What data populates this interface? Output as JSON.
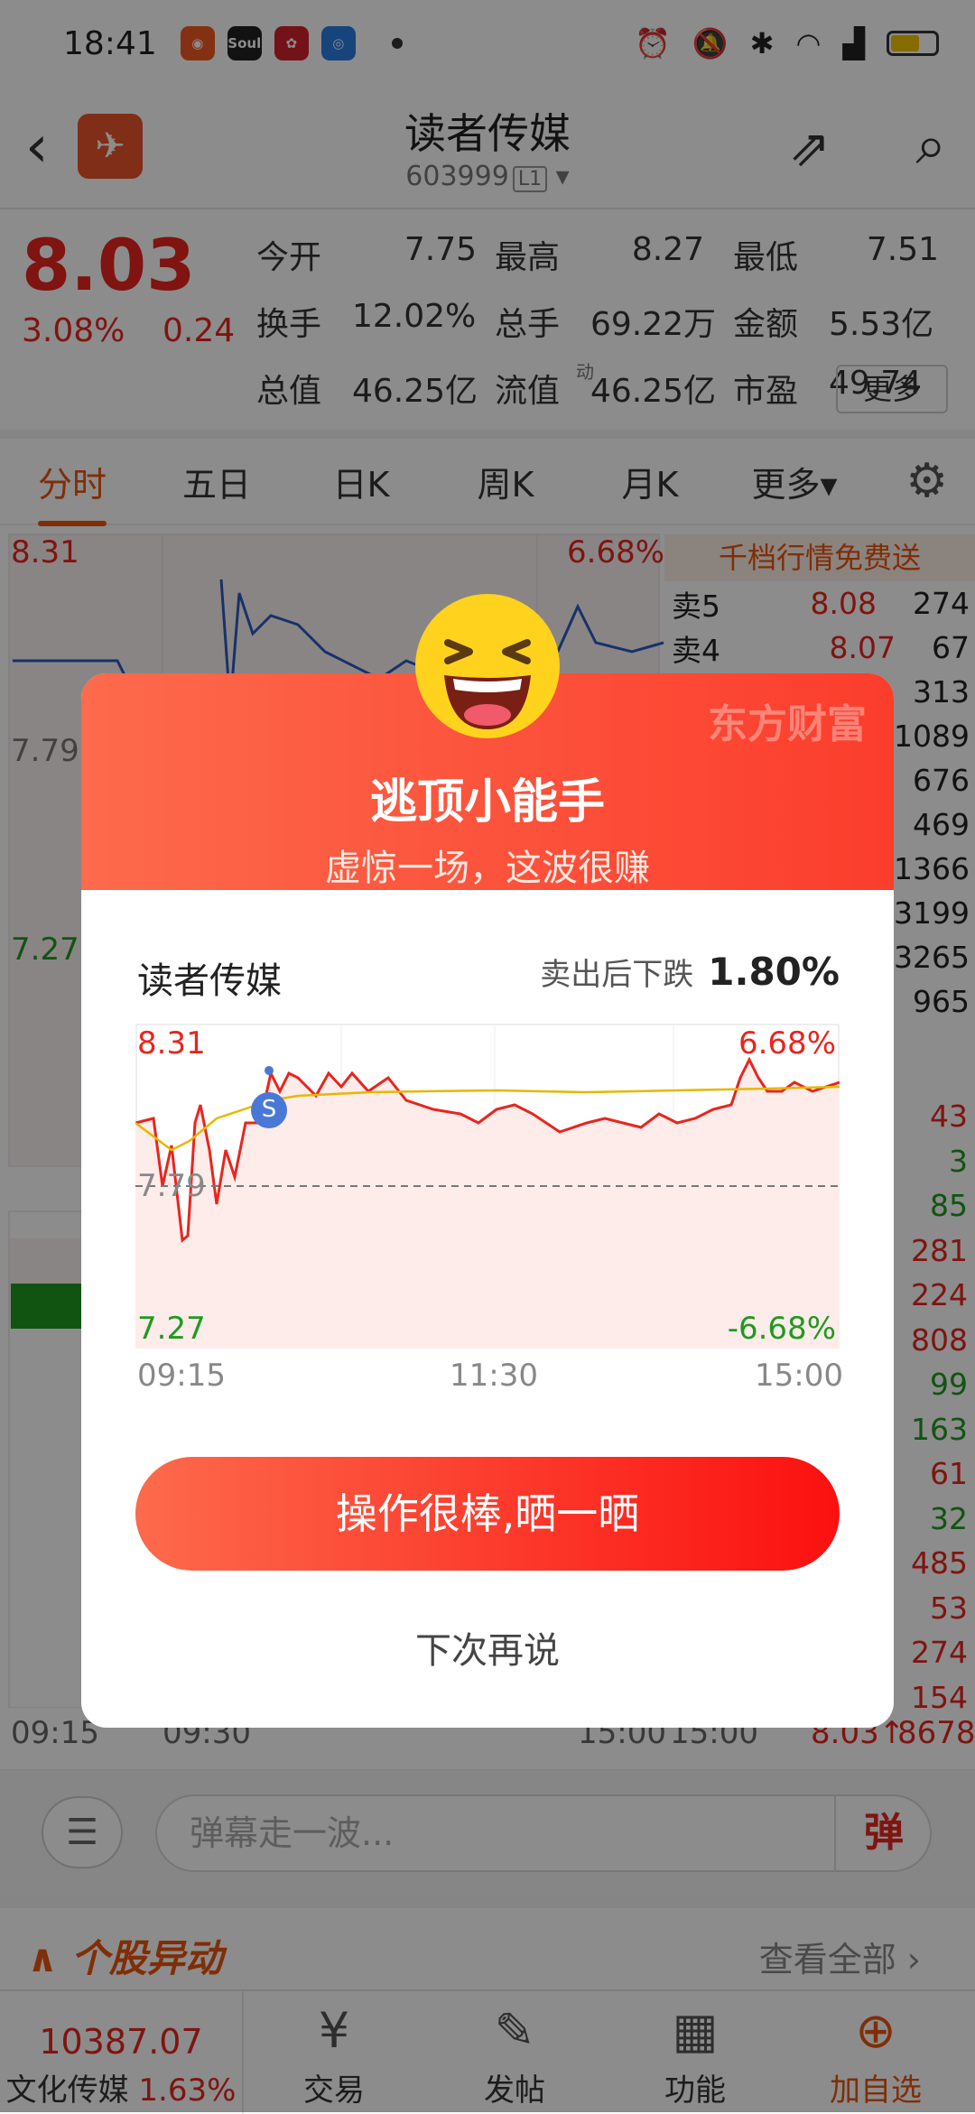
{
  "status": {
    "time": "18:41",
    "apps": [
      "Soul"
    ]
  },
  "header": {
    "title": "读者传媒",
    "code": "603999",
    "level": "L1"
  },
  "quote": {
    "price": "8.03",
    "pct": "3.08%",
    "chg": "0.24",
    "cells": [
      {
        "k": "今开",
        "v": "7.75",
        "c": "green"
      },
      {
        "k": "最高",
        "v": "8.27",
        "c": "red"
      },
      {
        "k": "最低",
        "v": "7.51",
        "c": "green"
      },
      {
        "k": "换手",
        "v": "12.02%",
        "c": ""
      },
      {
        "k": "总手",
        "v": "69.22万",
        "c": ""
      },
      {
        "k": "金额",
        "v": "5.53亿",
        "c": ""
      },
      {
        "k": "总值",
        "v": "46.25亿",
        "c": ""
      },
      {
        "k": "流值",
        "v": "46.25亿",
        "c": ""
      },
      {
        "k": "市盈",
        "v": "49.74",
        "c": ""
      }
    ],
    "pe_tag": "动",
    "more": "更多"
  },
  "tabs": [
    "分时",
    "五日",
    "日K",
    "周K",
    "月K",
    "更多▾"
  ],
  "bg_chart": {
    "high": "8.31",
    "mid": "7.79",
    "low": "7.27",
    "pct_high": "6.68%",
    "t1": "09:15",
    "t2": "09:30",
    "t3": "15:00"
  },
  "orderbook": {
    "free": "千档行情免费送",
    "rows": [
      {
        "n": "卖5",
        "p": "8.08",
        "v": "274"
      },
      {
        "n": "卖4",
        "p": "8.07",
        "v": "67"
      },
      {
        "n": "",
        "p": "",
        "v": "313"
      },
      {
        "n": "",
        "p": "",
        "v": "1089"
      },
      {
        "n": "",
        "p": "",
        "v": "676"
      },
      {
        "n": "",
        "p": "",
        "v": "469"
      },
      {
        "n": "",
        "p": "",
        "v": "1366"
      },
      {
        "n": "",
        "p": "",
        "v": "3199"
      },
      {
        "n": "",
        "p": "",
        "v": "3265"
      },
      {
        "n": "",
        "p": "",
        "v": "965"
      }
    ],
    "trades": [
      {
        "v": "43",
        "c": "red"
      },
      {
        "v": "3",
        "c": "green"
      },
      {
        "v": "85",
        "c": "green"
      },
      {
        "v": "281",
        "c": "red"
      },
      {
        "v": "224",
        "c": "red"
      },
      {
        "v": "808",
        "c": "red"
      },
      {
        "v": "99",
        "c": "green"
      },
      {
        "v": "163",
        "c": "green"
      },
      {
        "v": "61",
        "c": "red"
      },
      {
        "v": "32",
        "c": "green"
      },
      {
        "v": "485",
        "c": "red"
      },
      {
        "v": "53",
        "c": "red"
      },
      {
        "v": "274",
        "c": "red"
      },
      {
        "v": "154",
        "c": "red"
      }
    ],
    "last": {
      "time": "15:00",
      "price": "8.03↑",
      "vol": "8678"
    }
  },
  "danmu": {
    "placeholder": "弹幕走一波...",
    "btn": "弹"
  },
  "movers": {
    "title": "个股异动",
    "all": "查看全部"
  },
  "tabbar": {
    "index_value": "10387.07",
    "index_name": "文化传媒",
    "index_pct": "1.63%",
    "items": [
      "交易",
      "发帖",
      "功能",
      "加自选"
    ]
  },
  "modal": {
    "brand": "东方财富",
    "title": "逃顶小能手",
    "subtitle": "虚惊一场，这波很赚",
    "stock": "读者传媒",
    "drop_label": "卖出后下跌",
    "drop_value": "1.80%",
    "chart": {
      "high": "8.31",
      "mid": "7.79",
      "low": "7.27",
      "pct_high": "6.68%",
      "pct_low": "-6.68%",
      "marker": "S"
    },
    "times": [
      "09:15",
      "11:30",
      "15:00"
    ],
    "button": "操作很棒,晒一晒",
    "later": "下次再说"
  },
  "colors": {
    "up": "#e8251e",
    "down": "#1f9a1f",
    "accent": "#e8540e"
  }
}
